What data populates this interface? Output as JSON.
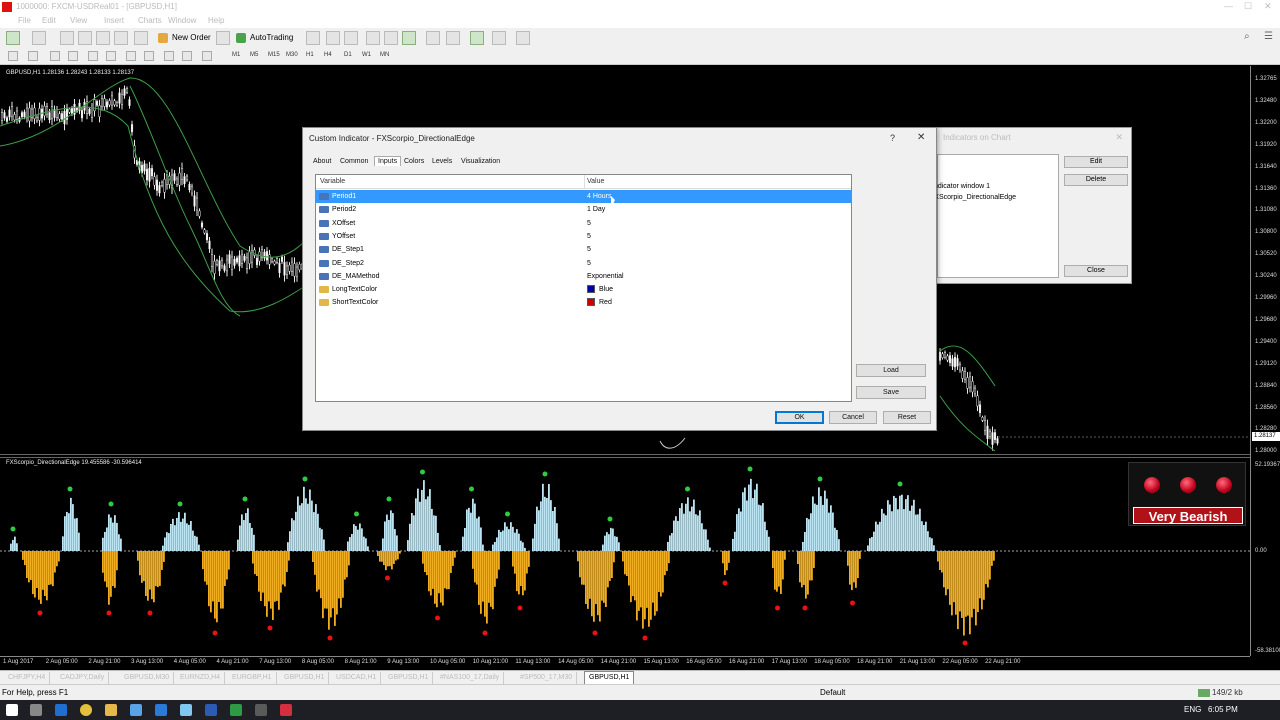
{
  "window": {
    "title": "1000000: FXCM-USDReal01 - [GBPUSD,H1]"
  },
  "menu": [
    "File",
    "Edit",
    "View",
    "Insert",
    "Charts",
    "Window",
    "Help"
  ],
  "toolbar": {
    "new_order": "New Order",
    "autotrading": "AutoTrading",
    "timeframes": [
      "M1",
      "M5",
      "M15",
      "M30",
      "H1",
      "H4",
      "D1",
      "W1",
      "MN"
    ]
  },
  "chart": {
    "info": "GBPUSD,H1  1.28136 1.28243 1.28133 1.28137",
    "indicator_info": "FXScorpio_DirectionalEdge 19.455586 -30.596414",
    "price_ticks": [
      "1.32765",
      "1.32480",
      "1.32200",
      "1.31920",
      "1.31640",
      "1.31360",
      "1.31080",
      "1.30800",
      "1.30520",
      "1.30240",
      "1.29960",
      "1.29680",
      "1.29400",
      "1.29120",
      "1.28840",
      "1.28560",
      "1.28280",
      "1.28000"
    ],
    "current_price": "1.28137",
    "ind_ticks": [
      "52.19367",
      "0.00",
      "-58.38100"
    ],
    "time_ticks": [
      "1 Aug 2017",
      "2 Aug 05:00",
      "2 Aug 21:00",
      "3 Aug 13:00",
      "4 Aug 05:00",
      "4 Aug 21:00",
      "7 Aug 13:00",
      "8 Aug 05:00",
      "8 Aug 21:00",
      "9 Aug 13:00",
      "10 Aug 05:00",
      "10 Aug 21:00",
      "11 Aug 13:00",
      "14 Aug 05:00",
      "14 Aug 21:00",
      "15 Aug 13:00",
      "16 Aug 05:00",
      "16 Aug 21:00",
      "17 Aug 13:00",
      "18 Aug 05:00",
      "18 Aug 21:00",
      "21 Aug 13:00",
      "22 Aug 05:00",
      "22 Aug 21:00"
    ]
  },
  "signal": {
    "label": "Very Bearish",
    "color": "#c0001c"
  },
  "dialog": {
    "title": "Custom Indicator - FXScorpio_DirectionalEdge",
    "help": "?",
    "close": "✕",
    "tabs": [
      "About",
      "Common",
      "Inputs",
      "Colors",
      "Levels",
      "Visualization"
    ],
    "active_tab": "Inputs",
    "columns": {
      "variable": "Variable",
      "value": "Value"
    },
    "rows": [
      {
        "variable": "Period1",
        "value": "4 Hours",
        "icon": "num"
      },
      {
        "variable": "Period2",
        "value": "1 Day",
        "icon": "num"
      },
      {
        "variable": "XOffset",
        "value": "5",
        "icon": "num"
      },
      {
        "variable": "YOffset",
        "value": "5",
        "icon": "num"
      },
      {
        "variable": "DE_Step1",
        "value": "5",
        "icon": "num"
      },
      {
        "variable": "DE_Step2",
        "value": "5",
        "icon": "num"
      },
      {
        "variable": "DE_MAMethod",
        "value": "Exponential",
        "icon": "num"
      },
      {
        "variable": "LongTextColor",
        "value": "Blue",
        "icon": "col",
        "swatch": "#0000aa"
      },
      {
        "variable": "ShortTextColor",
        "value": "Red",
        "icon": "col",
        "swatch": "#cc0000"
      }
    ],
    "buttons": {
      "load": "Load",
      "save": "Save",
      "ok": "OK",
      "cancel": "Cancel",
      "reset": "Reset"
    }
  },
  "bg_dialog": {
    "title": "Indicators on Chart",
    "items": [
      "Indicator window 1",
      "FXScorpio_DirectionalEdge"
    ],
    "buttons": {
      "edit": "Edit",
      "delete": "Delete",
      "close": "Close"
    }
  },
  "symbol_tabs": [
    "CHFJPY,H4",
    "CADJPY,Daily",
    "GBPUSD,M30",
    "EURNZD,H4",
    "EURGBP,H1",
    "GBPUSD,H1",
    "USDCAD,H1",
    "GBPUSD,H1",
    "#NAS100_17,Daily",
    "#SP500_17,M30",
    "GBPUSD,H1"
  ],
  "active_symbol_tab": 10,
  "status": {
    "help": "For Help, press F1",
    "profile": "Default",
    "connection": "149/2 kb"
  },
  "tray": {
    "lang": "ENG",
    "time": "6:05 PM"
  }
}
